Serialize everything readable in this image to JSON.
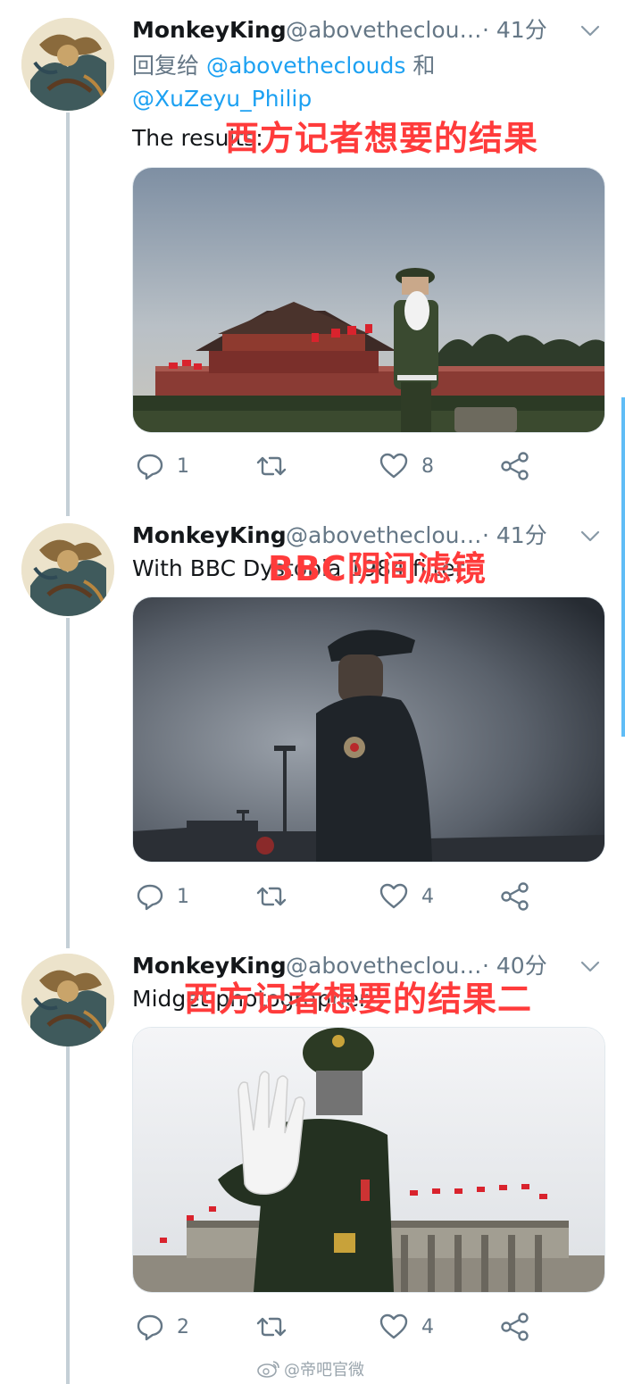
{
  "tweets": [
    {
      "name": "MonkeyKing",
      "handle": "@abovetheclou…",
      "time": "· 41分",
      "reply_prefix": "回复给",
      "reply_mention_1": "@abovetheclouds",
      "reply_and": "和",
      "reply_mention_2": "@XuZeyu_Philip",
      "text": "The results:",
      "overlay": "西方记者想要的结果",
      "replies": "1",
      "retweets": "",
      "likes": "8"
    },
    {
      "name": "MonkeyKing",
      "handle": "@abovetheclou…",
      "time": "· 41分",
      "text": "With BBC Dystopia 1984 filter",
      "overlay": "BBC阴间滤镜",
      "replies": "1",
      "retweets": "",
      "likes": "4"
    },
    {
      "name": "MonkeyKing",
      "handle": "@abovetheclou…",
      "time": "· 40分",
      "text": "Midget photographer",
      "overlay": "西方记者想要的结果二",
      "replies": "2",
      "retweets": "",
      "likes": "4"
    }
  ],
  "watermark": "@帝吧官微",
  "icons": {
    "reply": "reply-icon",
    "retweet": "retweet-icon",
    "like": "heart-icon",
    "share": "share-icon",
    "caret": "chevron-down-icon"
  },
  "colors": {
    "link": "#1da1f2",
    "secondary": "#657786",
    "overlay_text": "#ff3b3b",
    "thread_line": "#c4cfd6"
  }
}
